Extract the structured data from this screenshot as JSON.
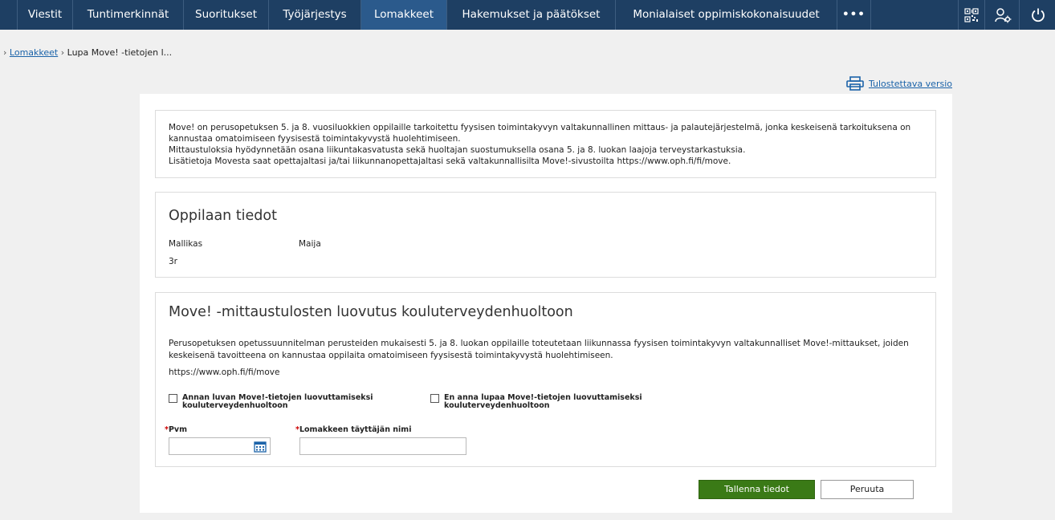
{
  "nav": {
    "tabs": [
      {
        "label": "Viestit"
      },
      {
        "label": "Tuntimerkinnät"
      },
      {
        "label": "Suoritukset"
      },
      {
        "label": "Työjärjestys"
      },
      {
        "label": "Lomakkeet"
      },
      {
        "label": "Hakemukset ja päätökset"
      },
      {
        "label": "Monialaiset oppimiskokonaisuudet"
      },
      {
        "label": "•••"
      }
    ],
    "active_tab": "Lomakkeet",
    "icons": [
      "qr-code-icon",
      "user-settings-icon",
      "power-icon"
    ],
    "colors": {
      "bar": "#1e3f63",
      "active": "#2b5a8c"
    }
  },
  "breadcrumb": {
    "prefix": "›",
    "link": "Lomakkeet",
    "separator": "›",
    "current": "Lupa Move! -tietojen l..."
  },
  "print_link": "Tulostettava versio",
  "intro": {
    "lines": [
      "Move! on perusopetuksen 5. ja 8. vuosiluokkien oppilaille tarkoitettu fyysisen toimintakyvyn valtakunnallinen mittaus- ja palautejärjestelmä, jonka keskeisenä tarkoituksena on kannustaa omatoimiseen fyysisestä toimintakyvystä huolehtimiseen.",
      "Mittaustuloksia hyödynnetään osana liikuntakasvatusta sekä huoltajan suostumuksella osana 5. ja 8. luokan laajoja terveystarkastuksia.",
      "Lisätietoja Movesta saat opettajaltasi ja/tai liikunnanopettajaltasi sekä valtakunnallisilta Move!-sivustoilta https://www.oph.fi/fi/move."
    ]
  },
  "student": {
    "title": "Oppilaan tiedot",
    "last_name": "Mallikas",
    "first_name": "Maija",
    "class": "3r"
  },
  "consent": {
    "title": "Move! -mittaustulosten luovutus kouluterveydenhuoltoon",
    "text": "Perusopetuksen opetussuunnitelman perusteiden mukaisesti 5. ja 8. luokan oppilaille toteutetaan liikunnassa fyysisen toimintakyvyn valtakunnalliset Move!-mittaukset, joiden keskeisenä tavoitteena on kannustaa oppilaita omatoimiseen fyysisestä toimintakyvystä huolehtimiseen.",
    "url": "https://www.oph.fi/fi/move",
    "option_allow": {
      "line1": "Annan luvan Move!-tietojen luovuttamiseksi",
      "line2": "kouluterveydenhuoltoon",
      "checked": false
    },
    "option_deny": {
      "line1": "En anna lupaa Move!-tietojen luovuttamiseksi",
      "line2": "kouluterveydenhuoltoon",
      "checked": false
    },
    "date_label": "Pvm",
    "date_value": "",
    "name_label": "Lomakkeen täyttäjän nimi",
    "name_value": "",
    "required_mark": "*"
  },
  "buttons": {
    "save": "Tallenna tiedot",
    "cancel": "Peruuta",
    "save_color": "#3a7a16"
  }
}
